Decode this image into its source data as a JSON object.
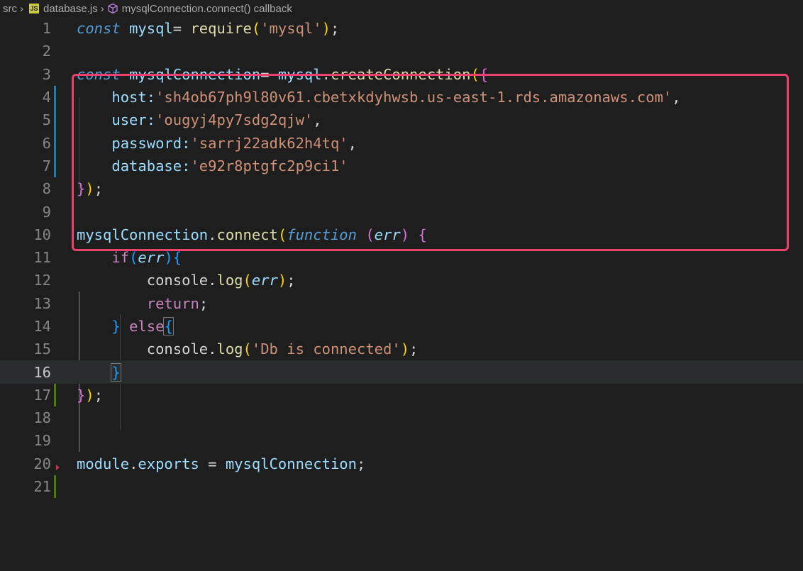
{
  "breadcrumb": {
    "folder": "src",
    "file_icon": "JS",
    "file": "database.js",
    "symbol_icon": "cube-icon",
    "symbol": "mysqlConnection.connect() callback"
  },
  "lines": {
    "n1": "1",
    "n2": "2",
    "n3": "3",
    "n4": "4",
    "n5": "5",
    "n6": "6",
    "n7": "7",
    "n8": "8",
    "n9": "9",
    "n10": "10",
    "n11": "11",
    "n12": "12",
    "n13": "13",
    "n14": "14",
    "n15": "15",
    "n16": "16",
    "n17": "17",
    "n18": "18",
    "n19": "19",
    "n20": "20",
    "n21": "21"
  },
  "code": {
    "const": "const",
    "mysql": "mysql",
    "eq": "= ",
    "require": "require",
    "mysql_str": "'mysql'",
    "mysqlConnection": "mysqlConnection",
    "createConnection": "createConnection",
    "host_key": "host:",
    "host_val": "'sh4ob67ph9l80v61.cbetxkdyhwsb.us-east-1.rds.amazonaws.com'",
    "user_key": "user:",
    "user_val": "'ougyj4py7sdg2qjw'",
    "password_key": "password:",
    "password_val": "'sarrj22adk62h4tq'",
    "database_key": "database:",
    "database_val": "'e92r8ptgfc2p9ci1'",
    "connect": "connect",
    "function": "function",
    "err": "err",
    "if": "if",
    "console": "console",
    "log": "log",
    "return": "return",
    "else": "else",
    "db_msg": "'Db is connected'",
    "module": "module",
    "exports": "exports"
  },
  "colors": {
    "highlight_box": "#e8416b",
    "gutter_modified": "#1b81a8",
    "gutter_added": "#487e02"
  }
}
